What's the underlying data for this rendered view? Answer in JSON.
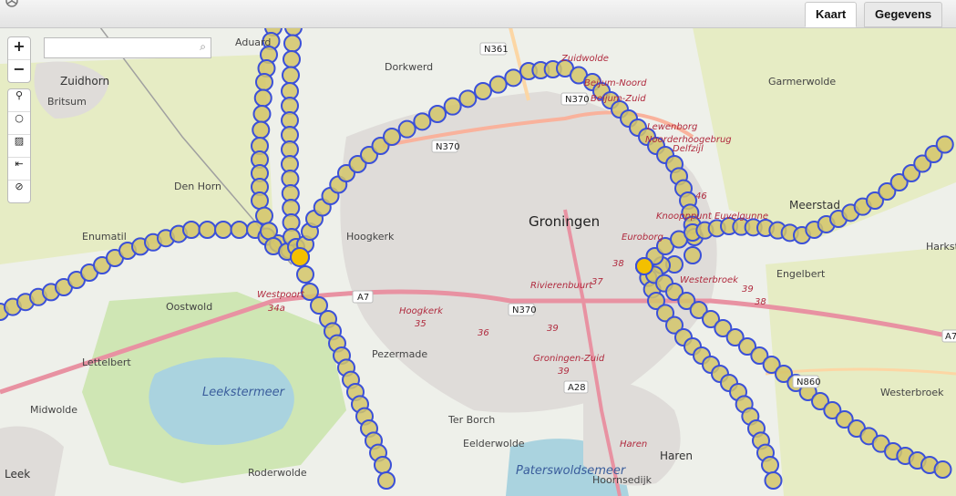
{
  "tabs": [
    {
      "label": "Kaart",
      "active": true
    },
    {
      "label": "Gegevens",
      "active": false
    }
  ],
  "controls": {
    "zoom_in": "+",
    "zoom_out": "−",
    "search_icon": "magnifier-icon",
    "extra": [
      "circle-icon",
      "image-icon",
      "first-page-icon",
      "cancel-icon"
    ]
  },
  "search": {
    "placeholder": "",
    "value": ""
  },
  "colors": {
    "land": "#eef0ea",
    "farmland": "#e8ecc8",
    "green": "#c8e3b0",
    "water": "#aad3df",
    "urban": "#e0dfdf",
    "motorway": "#e892a2",
    "trunk": "#f9b29c",
    "primary": "#fcd6a4",
    "track_fill": "#d4c56a",
    "track_stroke": "#3b50d8",
    "highlight_fill": "#f3c000"
  },
  "places": [
    {
      "name": "Groningen",
      "kind": "big"
    },
    {
      "name": "Zuidhorn",
      "kind": "town"
    },
    {
      "name": "Aduard",
      "kind": "small"
    },
    {
      "name": "Dorkwerd",
      "kind": "small"
    },
    {
      "name": "Britsum",
      "kind": "small"
    },
    {
      "name": "Den Horn",
      "kind": "small"
    },
    {
      "name": "Enumatil",
      "kind": "small"
    },
    {
      "name": "Hoogkerk",
      "kind": "small"
    },
    {
      "name": "Oostwold",
      "kind": "small"
    },
    {
      "name": "Lettelbert",
      "kind": "small"
    },
    {
      "name": "Midwolde",
      "kind": "small"
    },
    {
      "name": "Leek",
      "kind": "town"
    },
    {
      "name": "Roderwolde",
      "kind": "small"
    },
    {
      "name": "Pezermade",
      "kind": "small"
    },
    {
      "name": "Ter Borch",
      "kind": "small"
    },
    {
      "name": "Eelderwolde",
      "kind": "small"
    },
    {
      "name": "Haren",
      "kind": "town"
    },
    {
      "name": "Hoornsedijk",
      "kind": "small"
    },
    {
      "name": "Meerstad",
      "kind": "town"
    },
    {
      "name": "Harkst",
      "kind": "small"
    },
    {
      "name": "Engelbert",
      "kind": "small"
    },
    {
      "name": "Westerbroek",
      "kind": "small"
    },
    {
      "name": "Garmerwolde",
      "kind": "small"
    }
  ],
  "district_labels": [
    "Zuidwolde",
    "Beijum-Noord",
    "Beijum-Zuid",
    "Lewenborg",
    "Noorderhoogebrug",
    "Delfzijl",
    "Knoopppunt Euvelgunne",
    "Euroborg",
    "Westerbroek",
    "Rivierenbuurt",
    "Groningen-Zuid",
    "Westpoort",
    "Hoogkerk",
    "Haren"
  ],
  "water_labels": [
    "Leekstermeer",
    "Paterswoldsemeer"
  ],
  "road_labels": [
    "N361",
    "N370",
    "N370",
    "A7",
    "N370",
    "A28",
    "N860",
    "A7"
  ],
  "junction_numbers": [
    "34a",
    "35",
    "36",
    "37",
    "38",
    "39",
    "39",
    "39",
    "38",
    "46"
  ]
}
